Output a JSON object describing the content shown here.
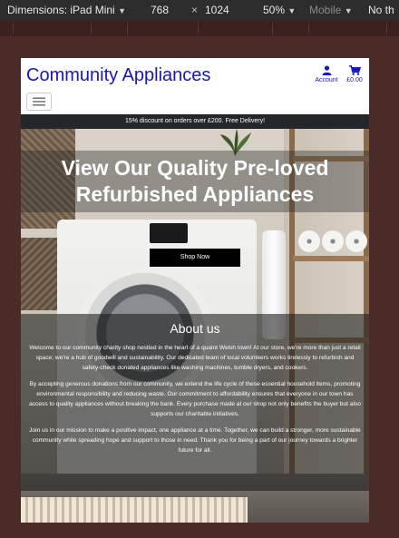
{
  "devtools": {
    "dimensions_label": "Dimensions: iPad Mini",
    "width": "768",
    "times": "×",
    "height": "1024",
    "zoom": "50%",
    "device_mode": "Mobile",
    "throttle": "No th"
  },
  "site": {
    "brand": "Community Appliances",
    "account_label": "Account",
    "cart_total": "£0.00",
    "promo": "15% discount on orders over £200. Free Delivery!"
  },
  "hero": {
    "title": "View Our Quality Pre-loved Refurbished Appliances",
    "cta": "Shop Now"
  },
  "about": {
    "heading": "About us",
    "paragraphs": [
      "Welcome to our community charity shop nestled in the heart of a quaint Welsh town! At our store, we're more than just a retail space; we're a hub of goodwill and sustainability. Our dedicated team of local volunteers works tirelessly to refurbish and safety-check donated appliances like washing machines, tumble dryers, and cookers.",
      "By accepting generous donations from our community, we extend the life cycle of these essential household items, promoting environmental responsibility and reducing waste. Our commitment to affordability ensures that everyone in our town has access to quality appliances without breaking the bank. Every purchase made at our shop not only benefits the buyer but also supports our charitable initiatives.",
      "Join us in our mission to make a positive impact, one appliance at a time. Together, we can build a stronger, more sustainable community while spreading hope and support to those in need. Thank you for being a part of our journey towards a brighter future for all."
    ]
  },
  "colors": {
    "brand": "#1414d4",
    "promo_bg": "#24262a",
    "page_bg": "#4a2b27"
  }
}
